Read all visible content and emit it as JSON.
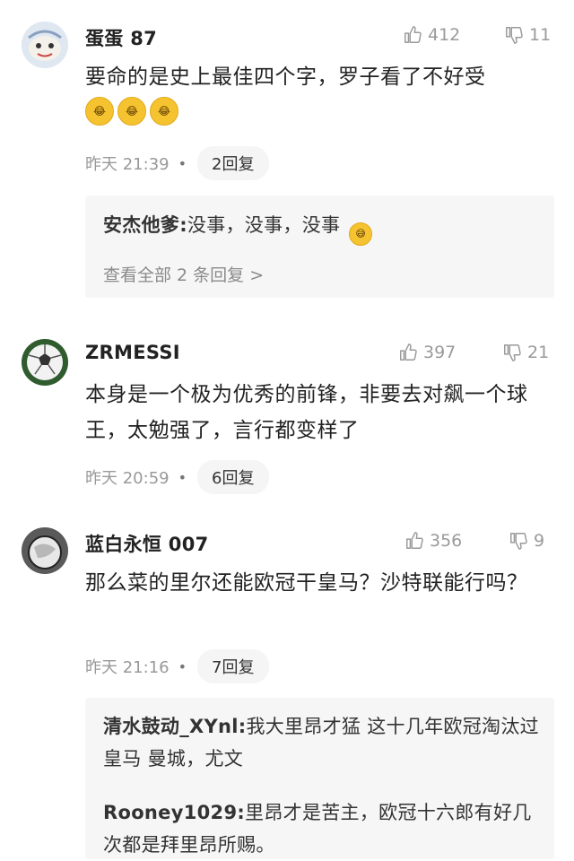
{
  "comments": [
    {
      "username": "蛋蛋 87",
      "likes": "412",
      "dislikes": "11",
      "content": "要命的是史上最佳四个字，罗子看了不好受",
      "emojis": [
        "cry-laugh-emoji",
        "cry-laugh-emoji",
        "cry-laugh-emoji"
      ],
      "time": "昨天 21:39",
      "reply_count": "2回复",
      "replies": [
        {
          "name": "安杰他爹",
          "text": "没事，没事，没事"
        }
      ],
      "view_all": "查看全部 2 条回复 >"
    },
    {
      "username": "ZRMESSI",
      "likes": "397",
      "dislikes": "21",
      "content": "本身是一个极为优秀的前锋，非要去对飙一个球王，太勉强了，言行都变样了",
      "time": "昨天 20:59",
      "reply_count": "6回复"
    },
    {
      "username": "蓝白永恒 007",
      "likes": "356",
      "dislikes": "9",
      "content": "那么菜的里尔还能欧冠干皇马？沙特联能行吗？",
      "time": "昨天 21:16",
      "reply_count": "7回复",
      "replies": [
        {
          "name": "清水鼓动_XYnl",
          "text": "我大里昂才猛 这十几年欧冠淘汰过皇马 曼城，尤文"
        },
        {
          "name": "Rooney1029",
          "text": "里昂才是苦主，欧冠十六郎有好几次都是拜里昂所赐。"
        }
      ]
    }
  ],
  "separator": ":",
  "dot": "•"
}
